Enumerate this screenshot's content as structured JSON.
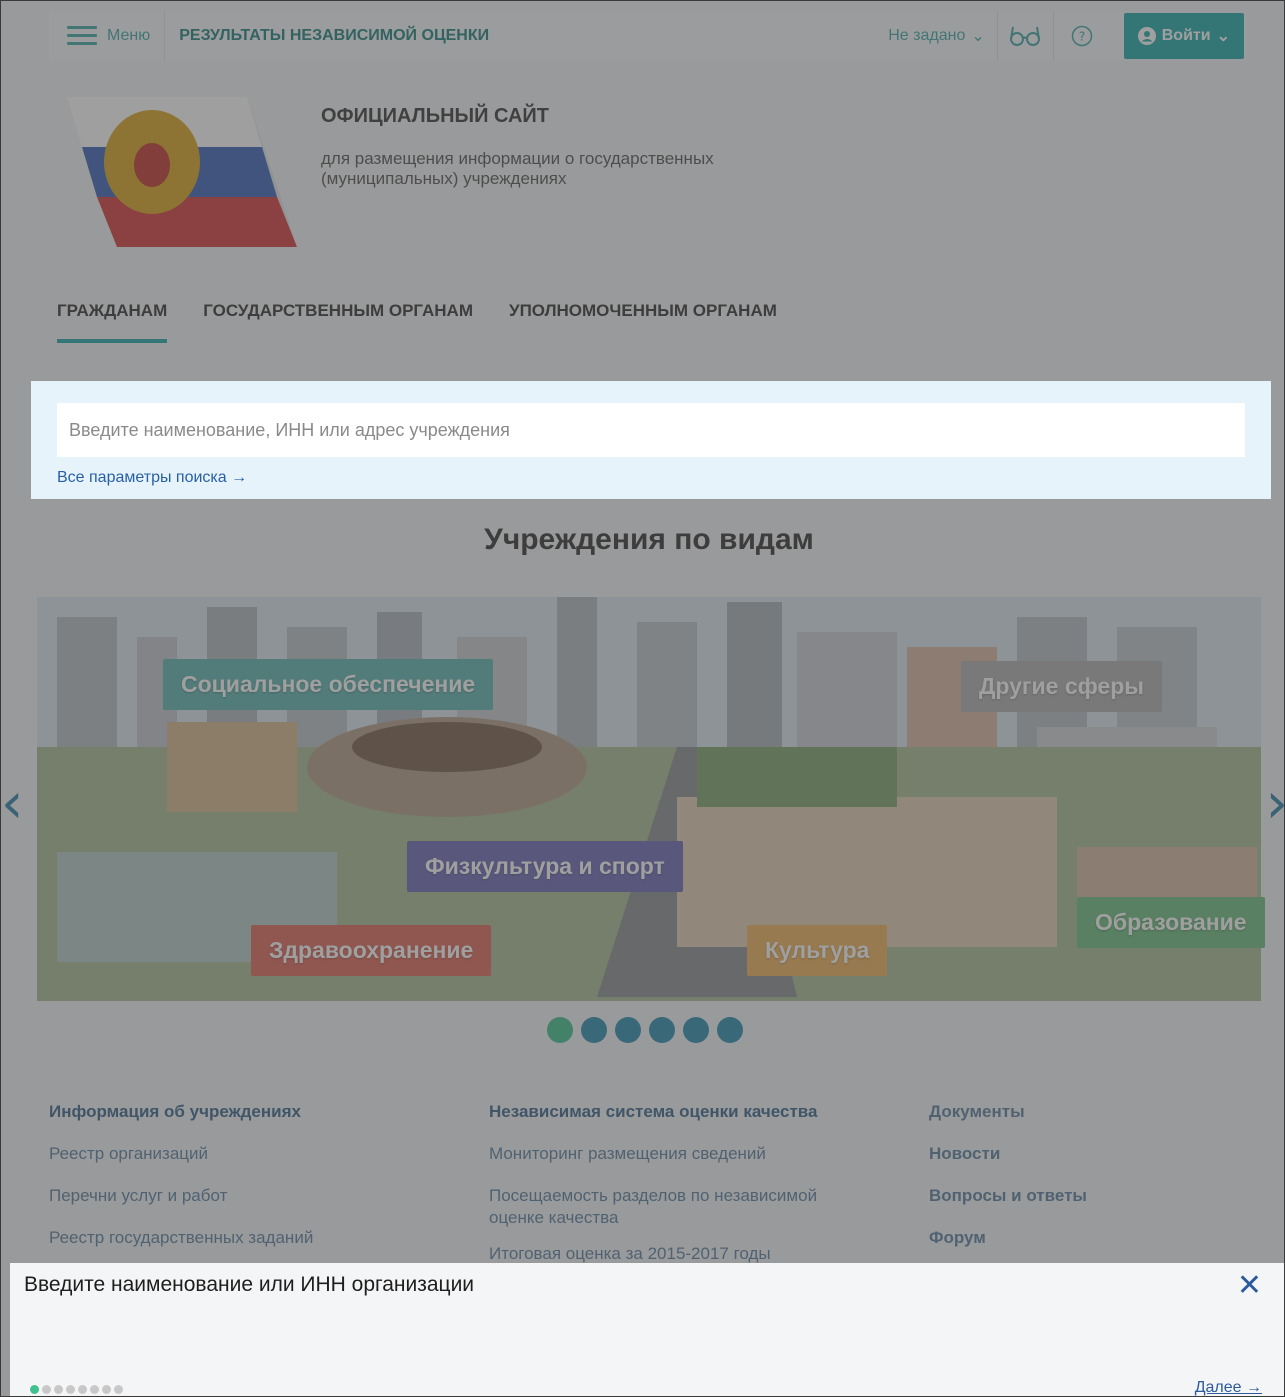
{
  "topbar": {
    "menu_label": "Меню",
    "title": "РЕЗУЛЬТАТЫ НЕЗАВИСИМОЙ ОЦЕНКИ",
    "region": "Не задано",
    "login_label": "Войти"
  },
  "header": {
    "title": "ОФИЦИАЛЬНЫЙ САЙТ",
    "subtitle": "для размещения информации о государственных (муниципальных) учреждениях"
  },
  "tabs": [
    {
      "label": "ГРАЖДАНАМ",
      "active": true
    },
    {
      "label": "ГОСУДАРСТВЕННЫМ ОРГАНАМ",
      "active": false
    },
    {
      "label": "УПОЛНОМОЧЕННЫМ ОРГАНАМ",
      "active": false
    }
  ],
  "search": {
    "placeholder": "Введите наименование, ИНН или адрес учреждения",
    "params_link": "Все параметры поиска →"
  },
  "carousel": {
    "title": "Учреждения по видам",
    "labels": {
      "social": "Социальное обеспечение",
      "other": "Другие сферы",
      "sport": "Физкультура и спорт",
      "health": "Здравоохранение",
      "culture": "Культура",
      "education": "Образование"
    },
    "slide_count": 6,
    "active_slide": 1
  },
  "footer": {
    "col1": [
      "Информация об учреждениях",
      "Реестр организаций",
      "Перечни услуг и работ",
      "Реестр государственных заданий"
    ],
    "col2": [
      "Независимая система оценки качества",
      "Мониторинг размещения сведений",
      "Посещаемость разделов по независимой оценке качества",
      "Итоговая оценка за 2015-2017 годы"
    ],
    "col3": [
      "Документы",
      "Новости",
      "Вопросы и ответы",
      "Форум"
    ]
  },
  "tip": {
    "text": "Введите наименование или ИНН организации",
    "next_label": "Далее →",
    "step_count": 8,
    "active_step": 1
  },
  "colors": {
    "accent": "#20a8a8",
    "link": "#2c5a9c",
    "social": "#5fb6b1",
    "other": "#b0b0b0",
    "sport": "#6f6ab7",
    "health": "#e0695a",
    "culture": "#f0b25a",
    "education": "#6dbf7f"
  }
}
